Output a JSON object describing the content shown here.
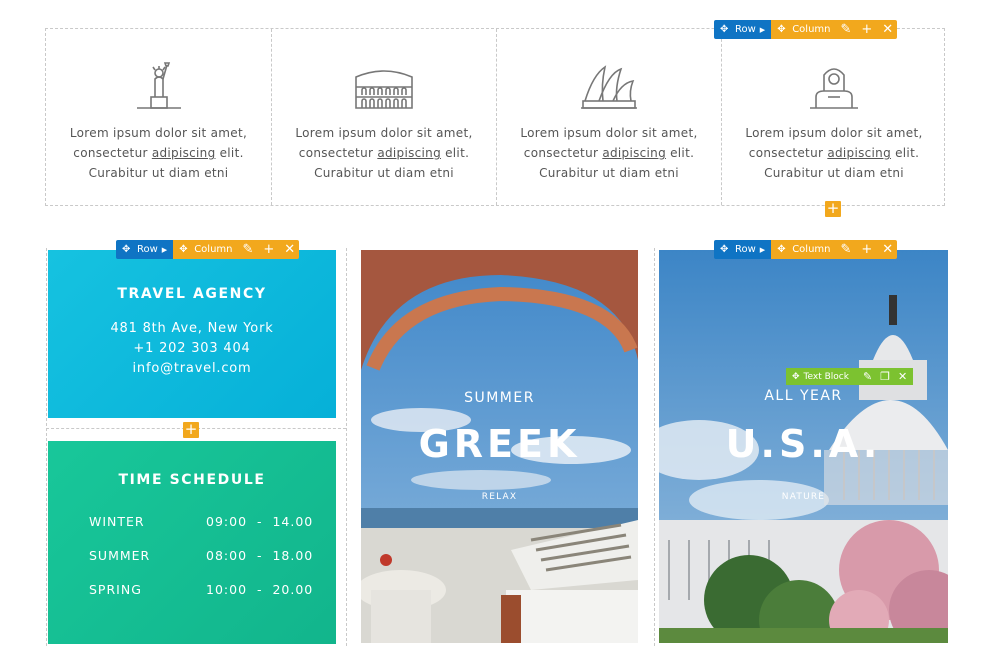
{
  "features": [
    {
      "icon": "statue-of-liberty-icon",
      "line1": "Lorem ipsum dolor sit amet,",
      "line2_pre": "consectetur ",
      "line2_link": "adipiscing",
      "line2_post": " elit.",
      "line3": "Curabitur ut diam etni"
    },
    {
      "icon": "colosseum-icon",
      "line1": "Lorem ipsum dolor sit amet,",
      "line2_pre": "consectetur ",
      "line2_link": "adipiscing",
      "line2_post": " elit.",
      "line3": "Curabitur ut diam etni"
    },
    {
      "icon": "sydney-opera-house-icon",
      "line1": "Lorem ipsum dolor sit amet,",
      "line2_pre": "consectetur ",
      "line2_link": "adipiscing",
      "line2_post": " elit.",
      "line3": "Curabitur ut diam etni"
    },
    {
      "icon": "sphinx-icon",
      "line1": "Lorem ipsum dolor sit amet,",
      "line2_pre": "consectetur ",
      "line2_link": "adipiscing",
      "line2_post": " elit.",
      "line3": "Curabitur ut diam etni"
    }
  ],
  "toolbar": {
    "row_label": "Row",
    "column_label": "Column",
    "text_block_label": "Text Block",
    "add_symbol": "+",
    "close_symbol": "✕",
    "edit_symbol": "✎"
  },
  "travel": {
    "title": "TRAVEL AGENCY",
    "address": "481 8th Ave, New York",
    "phone": "+1 202 303 404",
    "email": "info@travel.com"
  },
  "schedule": {
    "title": "TIME SCHEDULE",
    "rows": [
      {
        "season": "WINTER",
        "start": "09:00",
        "sep": "-",
        "end": "14.00"
      },
      {
        "season": "SUMMER",
        "start": "08:00",
        "sep": "-",
        "end": "18.00"
      },
      {
        "season": "SPRING",
        "start": "10:00",
        "sep": "-",
        "end": "20.00"
      }
    ]
  },
  "cards": [
    {
      "subtitle": "SUMMER",
      "title": "GREEK",
      "tag": "RELAX"
    },
    {
      "subtitle": "ALL YEAR",
      "title": "U.S.A.",
      "tag": "NATURE"
    }
  ],
  "colors": {
    "row": "#0f74c4",
    "column": "#f2a81d",
    "text_block": "#7cc230",
    "travel_bg": "#0ab8dd",
    "schedule_bg": "#15bf93"
  }
}
